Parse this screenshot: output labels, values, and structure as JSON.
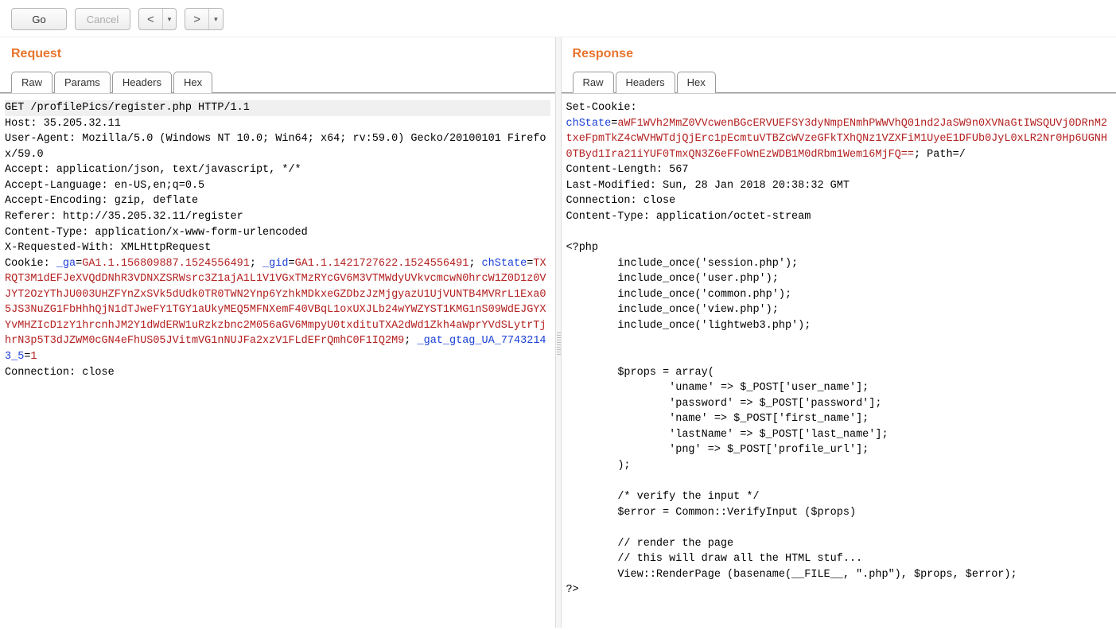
{
  "toolbar": {
    "go_label": "Go",
    "cancel_label": "Cancel",
    "prev_symbol": "<",
    "next_symbol": ">",
    "drop_symbol": "▾"
  },
  "request": {
    "title": "Request",
    "tabs": {
      "raw": "Raw",
      "params": "Params",
      "headers": "Headers",
      "hex": "Hex"
    },
    "line1": "GET /profilePics/register.php HTTP/1.1",
    "host": "Host: 35.205.32.11",
    "ua": "User-Agent: Mozilla/5.0 (Windows NT 10.0; Win64; x64; rv:59.0) Gecko/20100101 Firefox/59.0",
    "accept": "Accept: application/json, text/javascript, */*",
    "accept_lang": "Accept-Language: en-US,en;q=0.5",
    "accept_enc": "Accept-Encoding: gzip, deflate",
    "referer": "Referer: http://35.205.32.11/register",
    "content_type": "Content-Type: application/x-www-form-urlencoded",
    "xreq": "X-Requested-With: XMLHttpRequest",
    "cookie_prefix": "Cookie: ",
    "ga_name": "_ga",
    "ga_val": "GA1.1.156809887.1524556491",
    "gid_name": "_gid",
    "gid_val": "GA1.1.1421727622.1524556491",
    "chstate_name": "chState",
    "chstate_val": "TXRQT3M1dEFJeXVQdDNhR3VDNXZSRWsrc3Z1ajA1L1V1VGxTMzRYcGV6M3VTMWdyUVkvcmcwN0hrcW1Z0D1z0VJYT2OzYThJU003UHZFYnZxSVk5dUdk0TR0TWN2Ynp6YzhkMDkxeGZDbzJzMjgyazU1UjVUNTB4MVRrL1Exa05JS3NuZG1FbHhhQjN1dTJweFY1TGY1aUkyMEQ5MFNXemF40VBqL1oxUXJLb24wYWZYST1KMG1nS09WdEJGYXYvMHZIcD1zY1hrcnhJM2Y1dWdERW1uRzkzbnc2M056aGV6MmpyU0txdituTXA2dWd1Zkh4aWprYVdSLytrTjhrN3p5T3dJZWM0cGN4eFhUS05JVitmVG1nNUJFa2xzV1FLdEFrQmhC0F1IQ2M9",
    "gat_name": "_gat_gtag_UA_77432143_5",
    "gat_val": "1",
    "connection": "Connection: close"
  },
  "response": {
    "title": "Response",
    "tabs": {
      "raw": "Raw",
      "headers": "Headers",
      "hex": "Hex"
    },
    "set_cookie_label": "Set-Cookie:",
    "chstate_name": "chState",
    "chstate_val": "aWF1WVh2MmZ0VVcwenBGcERVUEFSY3dyNmpENmhPWWVhQ01nd2JaSW9n0XVNaGtIWSQUVj0DRnM2txeFpmTkZ4cWVHWTdjQjErc1pEcmtuVTBZcWVzeGFkTXhQNz1VZXFiM1UyeE1DFUb0JyL0xLR2Nr0Hp6UGNH0TByd1Ira21iYUF0TmxQN3Z6eFFoWnEzWDB1M0dRbm1Wem16MjFQ==",
    "set_cookie_suffix": "; Path=/",
    "content_length": "Content-Length: 567",
    "last_modified": "Last-Modified: Sun, 28 Jan 2018 20:38:32 GMT",
    "connection": "Connection: close",
    "content_type": "Content-Type: application/octet-stream",
    "body": "<?php\n        include_once('session.php');\n        include_once('user.php');\n        include_once('common.php');\n        include_once('view.php');\n        include_once('lightweb3.php');\n\n\n        $props = array(\n                'uname' => $_POST['user_name'];\n                'password' => $_POST['password'];\n                'name' => $_POST['first_name'];\n                'lastName' => $_POST['last_name'];\n                'png' => $_POST['profile_url'];\n        );\n\n        /* verify the input */\n        $error = Common::VerifyInput ($props)\n\n        // render the page\n        // this will draw all the HTML stuf...\n        View::RenderPage (basename(__FILE__, \".php\"), $props, $error);\n?>"
  }
}
